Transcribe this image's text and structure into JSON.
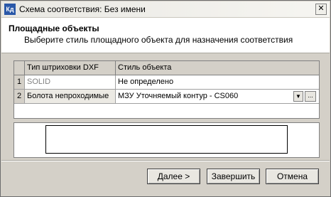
{
  "window": {
    "icon_label": "Кд",
    "title": "Схема соответствия: Без имени",
    "close_glyph": "✕"
  },
  "header": {
    "title": "Площадные объекты",
    "description": "Выберите стиль площадного объекта для назначения соответствия"
  },
  "grid": {
    "columns": [
      "Тип штриховки DXF",
      "Стиль объекта"
    ],
    "rows": [
      {
        "num": "1",
        "hatch": "SOLID",
        "style": "Не определено"
      },
      {
        "num": "2",
        "hatch": "Болота непроходимые",
        "style": "МЗУ Уточняемый контур - CS060"
      }
    ],
    "dropdown_glyph": "▼",
    "ellipsis_glyph": "..."
  },
  "buttons": {
    "next": "Далее >",
    "finish": "Завершить",
    "cancel": "Отмена"
  }
}
